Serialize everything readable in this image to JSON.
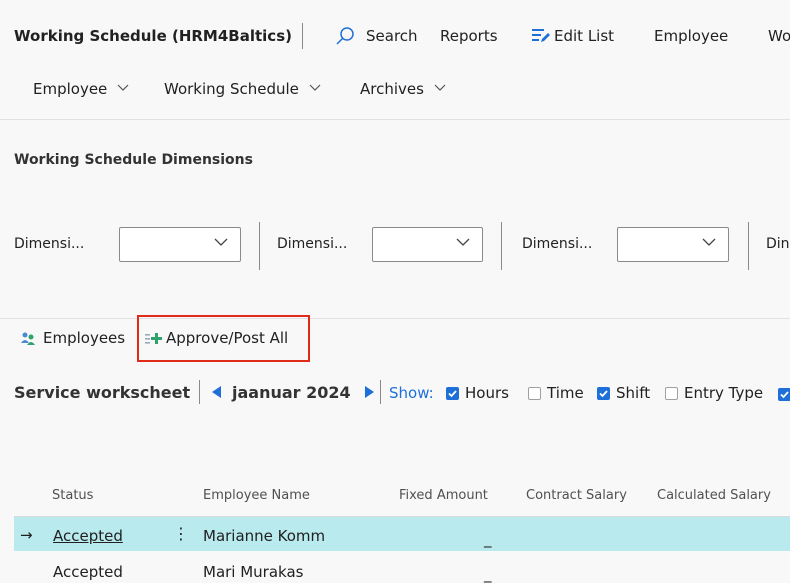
{
  "header": {
    "title": "Working Schedule (HRM4Baltics)",
    "actions": [
      {
        "label": "Search",
        "icon": "search-icon"
      },
      {
        "label": "Reports"
      },
      {
        "label": "Edit List",
        "icon": "edit-list-icon"
      },
      {
        "label": "Employee"
      },
      {
        "label": "Wo"
      }
    ]
  },
  "menus": [
    {
      "label": "Employee"
    },
    {
      "label": "Working Schedule"
    },
    {
      "label": "Archives"
    }
  ],
  "dimensions": {
    "section_title": "Working Schedule Dimensions",
    "filters": [
      {
        "label": "Dimensi...",
        "value": ""
      },
      {
        "label": "Dimensi...",
        "value": ""
      },
      {
        "label": "Dimensi...",
        "value": ""
      },
      {
        "label": "Din"
      }
    ]
  },
  "toolbar": {
    "employees_label": "Employees",
    "approve_post_label": "Approve/Post All",
    "highlight_color": "#e02a1a"
  },
  "worksheet": {
    "title": "Service workscheet",
    "period": "jaanuar 2024",
    "show_label": "Show:",
    "options": [
      {
        "label": "Hours",
        "checked": true
      },
      {
        "label": "Time",
        "checked": false
      },
      {
        "label": "Shift",
        "checked": true
      },
      {
        "label": "Entry Type",
        "checked": false
      }
    ],
    "overflow_checkbox_checked": true
  },
  "table": {
    "columns": [
      "Status",
      "Employee Name",
      "Fixed Amount",
      "Contract Salary",
      "Calculated Salary"
    ],
    "rows": [
      {
        "status": "Accepted",
        "employee_name": "Marianne Komm",
        "fixed_amount": "_",
        "selected": true
      },
      {
        "status": "Accepted",
        "employee_name": "Mari Murakas",
        "fixed_amount": "_",
        "selected": false
      }
    ],
    "selection_color": "#b8eaee"
  }
}
